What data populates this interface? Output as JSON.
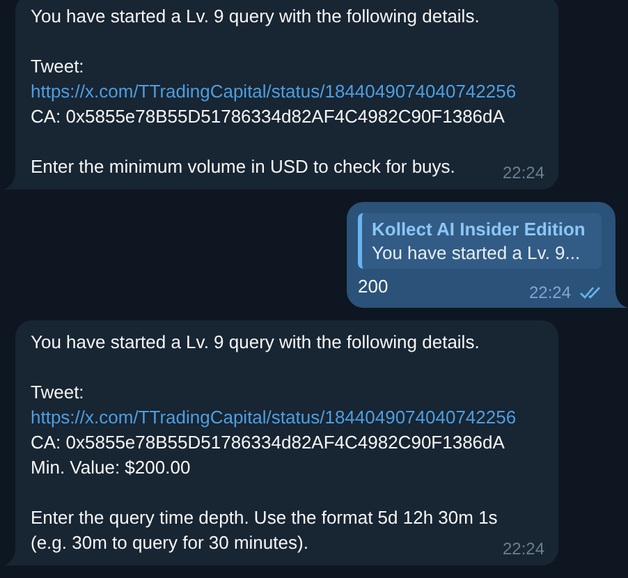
{
  "messages": [
    {
      "kind": "incoming",
      "time": "22:24",
      "blocks": [
        [
          {
            "kind": "text",
            "text": "You have started a Lv. 9 query with the following details."
          }
        ],
        [
          {
            "kind": "text",
            "text": "Tweet:"
          },
          {
            "kind": "link",
            "text": "https://x.com/TTradingCapital/status/1844049074040742256"
          },
          {
            "kind": "text",
            "text": "CA: 0x5855e78B55D51786334d82AF4C4982C90F1386dA"
          }
        ],
        [
          {
            "kind": "text",
            "text": "Enter the minimum volume in USD to check for buys."
          }
        ]
      ]
    },
    {
      "kind": "outgoing",
      "time": "22:24",
      "read": true,
      "reply": {
        "sender": "Kollect AI Insider Edition",
        "text": "You have started a Lv. 9..."
      },
      "blocks": [
        [
          {
            "kind": "text",
            "text": "200"
          }
        ]
      ]
    },
    {
      "kind": "incoming",
      "time": "22:24",
      "blocks": [
        [
          {
            "kind": "text",
            "text": "You have started a Lv. 9 query with the following details."
          }
        ],
        [
          {
            "kind": "text",
            "text": "Tweet:"
          },
          {
            "kind": "link",
            "text": "https://x.com/TTradingCapital/status/1844049074040742256"
          },
          {
            "kind": "text",
            "text": "CA: 0x5855e78B55D51786334d82AF4C4982C90F1386dA"
          },
          {
            "kind": "text",
            "text": "Min. Value: $200.00"
          }
        ],
        [
          {
            "kind": "text",
            "text": "Enter the query time depth. Use the format 5d 12h 30m 1s"
          },
          {
            "kind": "text",
            "text": "(e.g. 30m to query for 30 minutes)."
          }
        ]
      ]
    }
  ]
}
